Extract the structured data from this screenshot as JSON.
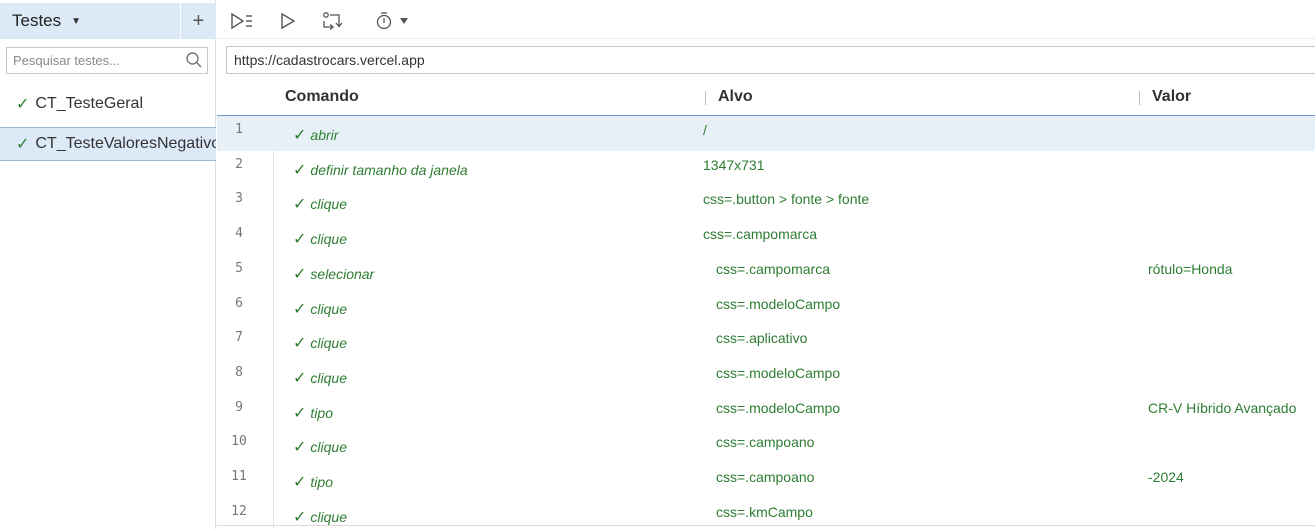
{
  "sidebar": {
    "title": "Testes",
    "add_label": "+",
    "search_placeholder": "Pesquisar testes...",
    "tests": [
      {
        "check": "✓",
        "name": "CT_TesteGeral"
      },
      {
        "check": "✓",
        "name": "CT_TesteValoresNegativos"
      }
    ]
  },
  "toolbar": {
    "icons": [
      "run-all-tests-icon",
      "run-current-test-icon",
      "step-over-icon",
      "speed-timer-icon",
      "dropdown-caret-icon"
    ]
  },
  "url": {
    "value": "https://cadastrocars.vercel.app"
  },
  "table": {
    "headers": {
      "command": "Comando",
      "target": "Alvo",
      "value": "Valor"
    },
    "rows": [
      {
        "num": "1",
        "command": "abrir",
        "target": "/",
        "value": ""
      },
      {
        "num": "2",
        "command": "definir tamanho da janela",
        "target": "1347x731",
        "value": ""
      },
      {
        "num": "3",
        "command": "clique",
        "target": "css=.button > fonte > fonte",
        "value": ""
      },
      {
        "num": "4",
        "command": "clique",
        "target": "css=.campomarca",
        "value": ""
      },
      {
        "num": "5",
        "command": "selecionar",
        "target": "css=.campomarca",
        "value": "rótulo=Honda"
      },
      {
        "num": "6",
        "command": "clique",
        "target": "css=.modeloCampo",
        "value": ""
      },
      {
        "num": "7",
        "command": "clique",
        "target": "css=.aplicativo",
        "value": ""
      },
      {
        "num": "8",
        "command": "clique",
        "target": "css=.modeloCampo",
        "value": ""
      },
      {
        "num": "9",
        "command": "tipo",
        "target": "css=.modeloCampo",
        "value": "CR-V Híbrido Avançado"
      },
      {
        "num": "10",
        "command": "clique",
        "target": "css=.campoano",
        "value": ""
      },
      {
        "num": "11",
        "command": "tipo",
        "target": "css=.campoano",
        "value": "-2024"
      },
      {
        "num": "12",
        "command": "clique",
        "target": "css=.kmCampo",
        "value": ""
      }
    ],
    "check": "✓"
  },
  "colors": {
    "accent_bg": "#dce9f7",
    "success_green": "#2e7d32",
    "header_rule": "#6b9bd8"
  }
}
